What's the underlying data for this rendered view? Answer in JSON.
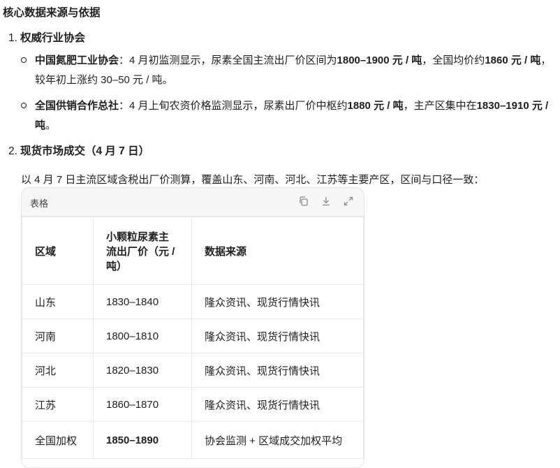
{
  "heading": "核心数据来源与依据",
  "items": [
    {
      "num": "1.",
      "title": "权威行业协会"
    },
    {
      "num": "2.",
      "title": "现货市场成交（4 月 7 日）"
    }
  ],
  "bullets": [
    {
      "name": "中国氮肥工业协会",
      "pre": "：4 月初监测显示，尿素全国主流出厂价区间为",
      "b1": "1800–1900 元 / 吨",
      "mid": "，全国均价约",
      "b2": "1860 元 / 吨",
      "post": "，较年初上涨约 30–50 元 / 吨。"
    },
    {
      "name": "全国供销合作总社",
      "pre": "：4 月上旬农资价格监测显示，尿素出厂价中枢约",
      "b1": "1880 元 / 吨",
      "mid": "，主产区集中在",
      "b2": "1830–1910 元 / 吨",
      "post": "。"
    }
  ],
  "intro": "以 4 月 7 日主流区域含税出厂价测算，覆盖山东、河南、河北、江苏等主要产区，区间与口径一致：",
  "table": {
    "label": "表格",
    "headers": [
      "区域",
      "小颗粒尿素主流出厂价（元 / 吨）",
      "数据来源"
    ],
    "rows": [
      [
        "山东",
        "1830–1840",
        "隆众资讯、现货行情快讯"
      ],
      [
        "河南",
        "1800–1810",
        "隆众资讯、现货行情快讯"
      ],
      [
        "河北",
        "1820–1830",
        "隆众资讯、现货行情快讯"
      ],
      [
        "江苏",
        "1860–1870",
        "隆众资讯、现货行情快讯"
      ],
      [
        "全国加权",
        "1850–1890",
        "协会监测 + 区域成交加权平均"
      ]
    ]
  }
}
